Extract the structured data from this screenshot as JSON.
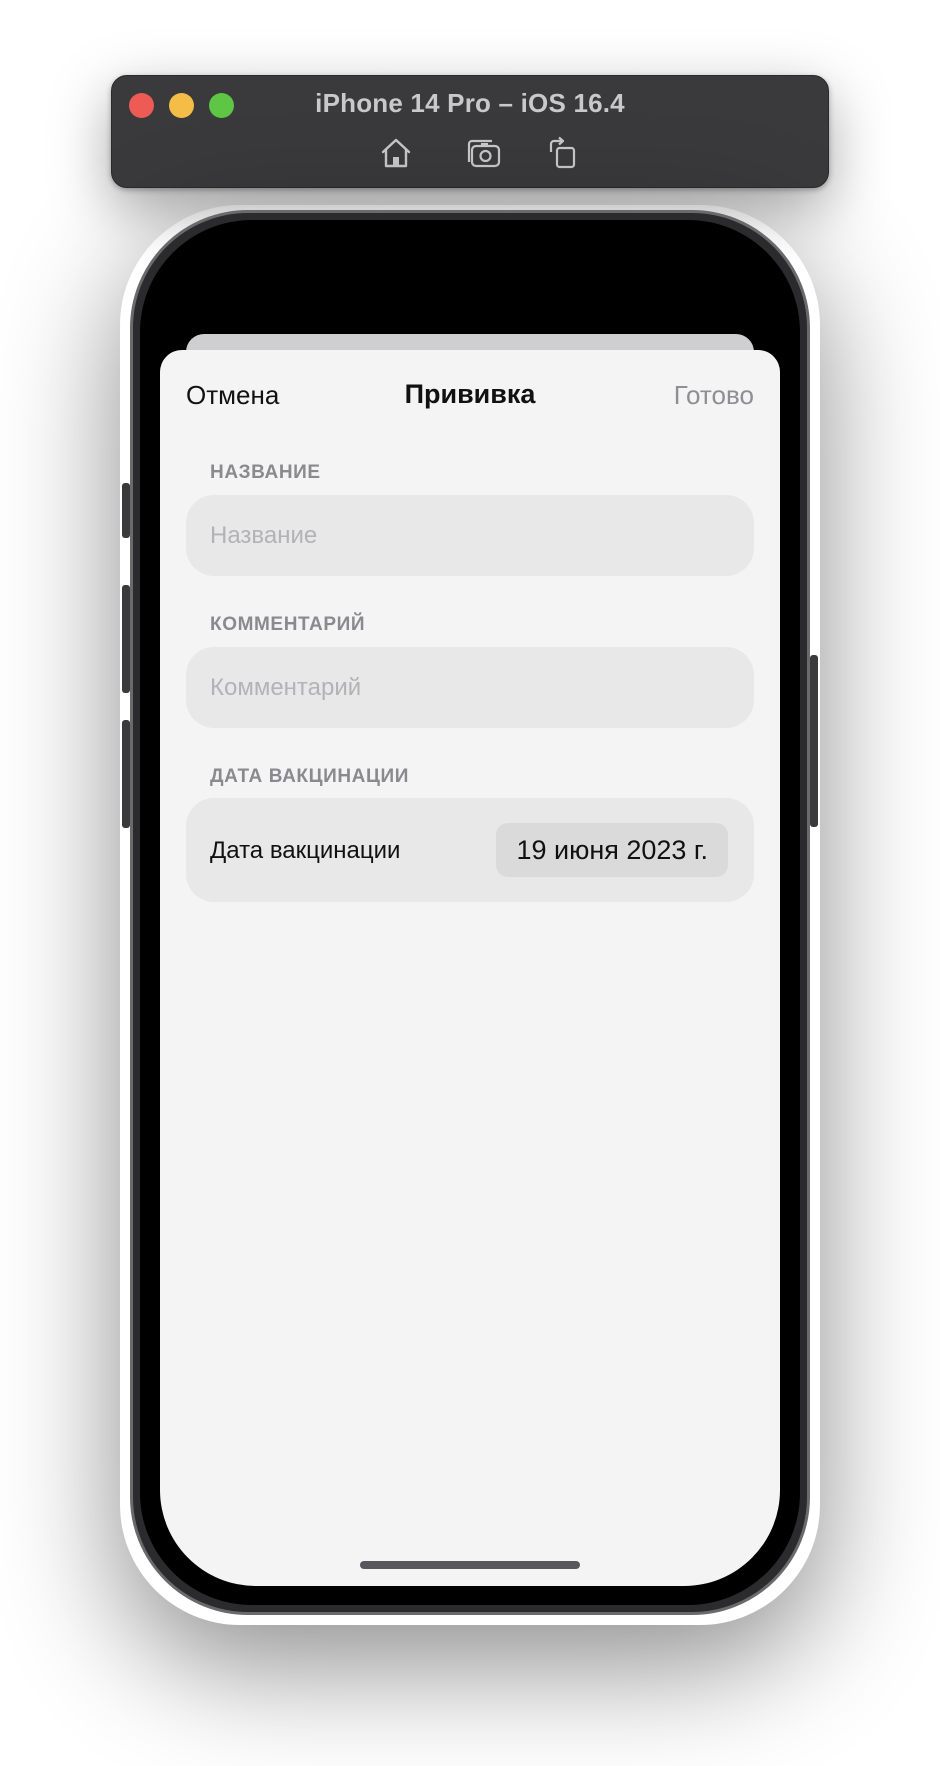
{
  "simulator": {
    "title": "iPhone 14 Pro – iOS 16.4",
    "toolbar": [
      "home-icon",
      "screenshot-icon",
      "rotate-icon"
    ],
    "colors": {
      "close": "#ee5b55",
      "minimize": "#f4bd48",
      "maximize": "#5fc544"
    }
  },
  "nav": {
    "cancel_label": "Отмена",
    "title": "Прививка",
    "done_label": "Готово"
  },
  "form": {
    "name_header": "НАЗВАНИЕ",
    "name_placeholder": "Название",
    "name_value": "",
    "comment_header": "КОММЕНТАРИЙ",
    "comment_placeholder": "Комментарий",
    "comment_value": "",
    "date_header": "ДАТА ВАКЦИНАЦИИ",
    "date_label": "Дата вакцинации",
    "date_value": "19 июня 2023 г."
  }
}
